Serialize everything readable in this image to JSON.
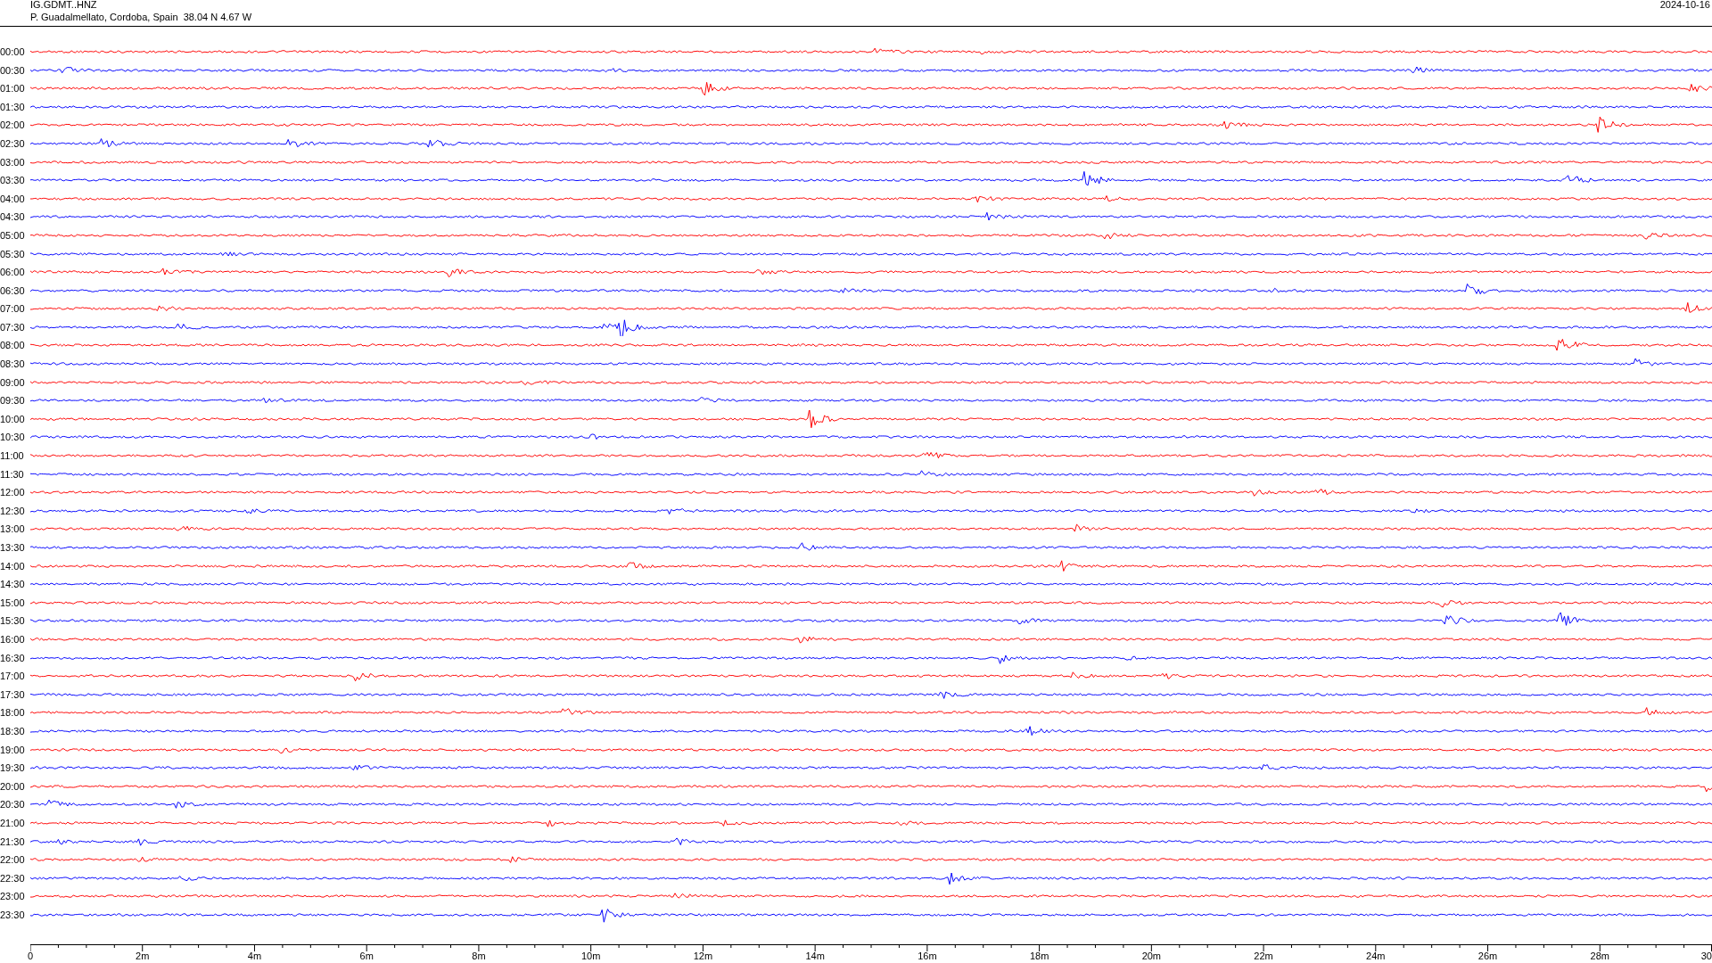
{
  "header": {
    "station": "IG.GDMT..HNZ",
    "location": "P. Guadalmellato, Cordoba, Spain  38.04 N 4.67 W",
    "date": "2024-10-16"
  },
  "rows": [
    {
      "time": "00:00",
      "color": "#ff0000"
    },
    {
      "time": "00:30",
      "color": "#0000ff"
    },
    {
      "time": "01:00",
      "color": "#ff0000"
    },
    {
      "time": "01:30",
      "color": "#0000ff"
    },
    {
      "time": "02:00",
      "color": "#ff0000"
    },
    {
      "time": "02:30",
      "color": "#0000ff"
    },
    {
      "time": "03:00",
      "color": "#ff0000"
    },
    {
      "time": "03:30",
      "color": "#0000ff"
    },
    {
      "time": "04:00",
      "color": "#ff0000"
    },
    {
      "time": "04:30",
      "color": "#0000ff"
    },
    {
      "time": "05:00",
      "color": "#ff0000"
    },
    {
      "time": "05:30",
      "color": "#0000ff"
    },
    {
      "time": "06:00",
      "color": "#ff0000"
    },
    {
      "time": "06:30",
      "color": "#0000ff"
    },
    {
      "time": "07:00",
      "color": "#ff0000"
    },
    {
      "time": "07:30",
      "color": "#0000ff"
    },
    {
      "time": "08:00",
      "color": "#ff0000"
    },
    {
      "time": "08:30",
      "color": "#0000ff"
    },
    {
      "time": "09:00",
      "color": "#ff0000"
    },
    {
      "time": "09:30",
      "color": "#0000ff"
    },
    {
      "time": "10:00",
      "color": "#ff0000"
    },
    {
      "time": "10:30",
      "color": "#0000ff"
    },
    {
      "time": "11:00",
      "color": "#ff0000"
    },
    {
      "time": "11:30",
      "color": "#0000ff"
    },
    {
      "time": "12:00",
      "color": "#ff0000"
    },
    {
      "time": "12:30",
      "color": "#0000ff"
    },
    {
      "time": "13:00",
      "color": "#ff0000"
    },
    {
      "time": "13:30",
      "color": "#0000ff"
    },
    {
      "time": "14:00",
      "color": "#ff0000"
    },
    {
      "time": "14:30",
      "color": "#0000ff"
    },
    {
      "time": "15:00",
      "color": "#ff0000"
    },
    {
      "time": "15:30",
      "color": "#0000ff"
    },
    {
      "time": "16:00",
      "color": "#ff0000"
    },
    {
      "time": "16:30",
      "color": "#0000ff"
    },
    {
      "time": "17:00",
      "color": "#ff0000"
    },
    {
      "time": "17:30",
      "color": "#0000ff"
    },
    {
      "time": "18:00",
      "color": "#ff0000"
    },
    {
      "time": "18:30",
      "color": "#0000ff"
    },
    {
      "time": "19:00",
      "color": "#ff0000"
    },
    {
      "time": "19:30",
      "color": "#0000ff"
    },
    {
      "time": "20:00",
      "color": "#ff0000"
    },
    {
      "time": "20:30",
      "color": "#0000ff"
    },
    {
      "time": "21:00",
      "color": "#ff0000"
    },
    {
      "time": "21:30",
      "color": "#0000ff"
    },
    {
      "time": "22:00",
      "color": "#ff0000"
    },
    {
      "time": "22:30",
      "color": "#0000ff"
    },
    {
      "time": "23:00",
      "color": "#ff0000"
    },
    {
      "time": "23:30",
      "color": "#0000ff"
    }
  ],
  "axis": {
    "labels": [
      "0",
      "2m",
      "4m",
      "6m",
      "8m",
      "10m",
      "12m",
      "14m",
      "16m",
      "18m",
      "20m",
      "22m",
      "24m",
      "26m",
      "28m",
      "30"
    ]
  }
}
